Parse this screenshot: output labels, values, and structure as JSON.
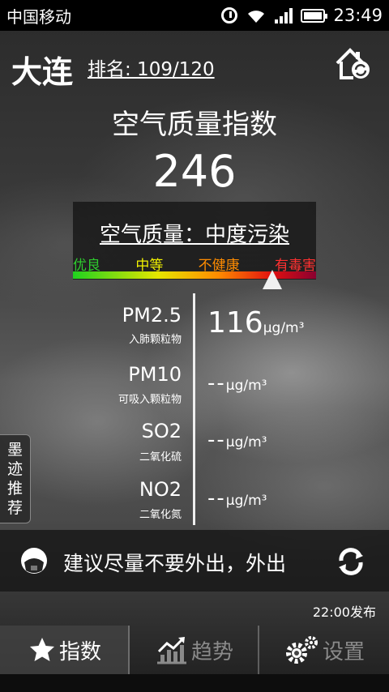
{
  "status_bar": {
    "carrier": "中国移动",
    "time": "23:49"
  },
  "header": {
    "city": "大连",
    "rank": "排名: 109/120"
  },
  "main": {
    "title": "空气质量指数",
    "aqi": "246"
  },
  "quality": {
    "label": "空气质量：中度污染",
    "levels": [
      {
        "label": "优良",
        "color": "#2ecc2e"
      },
      {
        "label": "中等",
        "color": "#f2f200"
      },
      {
        "label": "不健康",
        "color": "#ff8c00"
      },
      {
        "label": "有毒害",
        "color": "#ff3030"
      }
    ],
    "marker_fraction": 0.82
  },
  "pollutants": [
    {
      "name": "PM2.5",
      "sub": "入肺颗粒物",
      "value": "116",
      "unit": "μg/m³"
    },
    {
      "name": "PM10",
      "sub": "可吸入颗粒物",
      "value": "--",
      "unit": "μg/m³"
    },
    {
      "name": "SO2",
      "sub": "二氧化硫",
      "value": "--",
      "unit": "μg/m³"
    },
    {
      "name": "NO2",
      "sub": "二氧化氮",
      "value": "--",
      "unit": "μg/m³"
    }
  ],
  "side_tab": {
    "label": [
      "墨",
      "迹",
      "推",
      "荐"
    ]
  },
  "advice": {
    "text": "建议尽量不要外出，外出"
  },
  "publish": {
    "text": "22:00发布"
  },
  "nav": [
    {
      "label": "指数",
      "icon": "star-icon"
    },
    {
      "label": "趋势",
      "icon": "trend-icon"
    },
    {
      "label": "设置",
      "icon": "gear-icon"
    }
  ]
}
